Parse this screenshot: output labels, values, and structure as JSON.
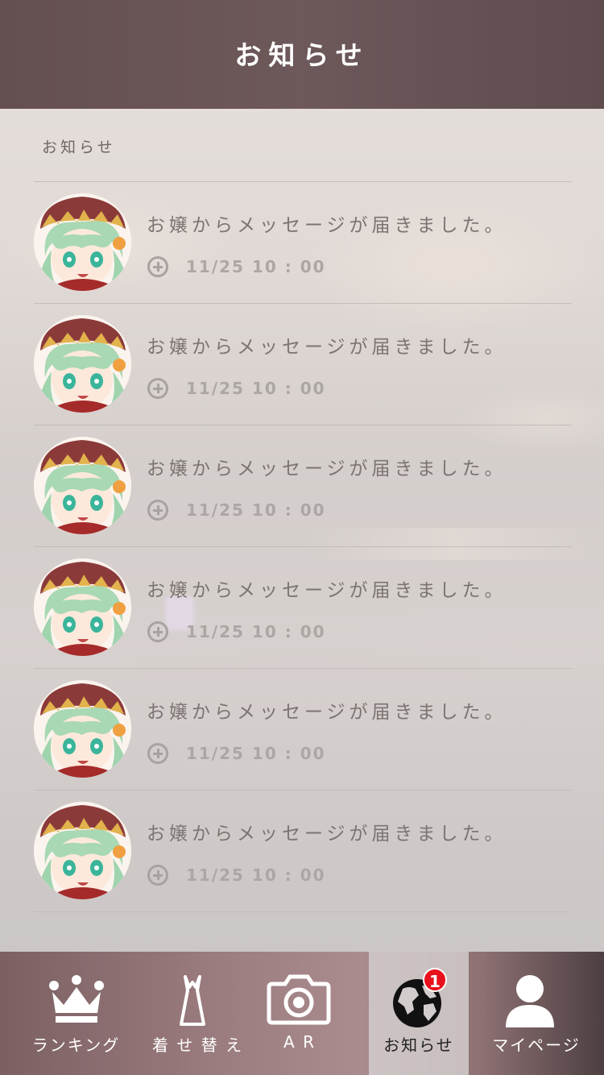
{
  "header": {
    "title": "お知らせ"
  },
  "section": {
    "title": "お知らせ"
  },
  "notifications": [
    {
      "message": "お嬢からメッセージが届きました。",
      "time": "11/25 10 : 00"
    },
    {
      "message": "お嬢からメッセージが届きました。",
      "time": "11/25 10 : 00"
    },
    {
      "message": "お嬢からメッセージが届きました。",
      "time": "11/25 10 : 00"
    },
    {
      "message": "お嬢からメッセージが届きました。",
      "time": "11/25 10 : 00"
    },
    {
      "message": "お嬢からメッセージが届きました。",
      "time": "11/25 10 : 00"
    },
    {
      "message": "お嬢からメッセージが届きました。",
      "time": "11/25 10 : 00"
    }
  ],
  "tabbar": {
    "tabs": [
      {
        "label": "ランキング",
        "icon": "crown-icon"
      },
      {
        "label": "着 せ 替 え",
        "icon": "dress-icon"
      },
      {
        "label": "A R",
        "icon": "camera-icon"
      },
      {
        "label": "お知らせ",
        "icon": "globe-icon",
        "badge": "1",
        "active": true
      },
      {
        "label": "マイページ",
        "icon": "person-icon"
      }
    ]
  },
  "colors": {
    "header_bg": "#6d585a",
    "badge": "#e8101c",
    "active_tab": "#d2cdcc"
  }
}
